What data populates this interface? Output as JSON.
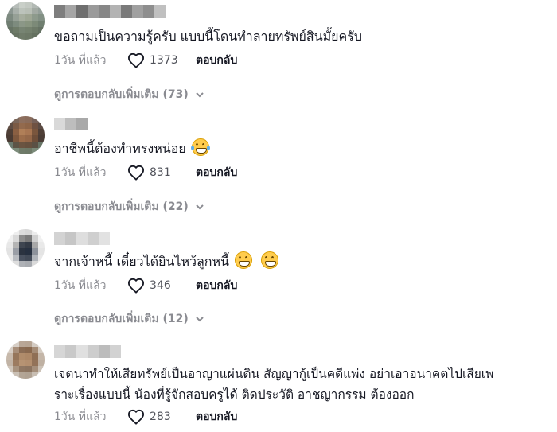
{
  "comments": [
    {
      "text": "ขอถามเป็นความรู้ครับ แบบนี้โดนทำลายทรัพย์สินมั้ยครับ",
      "time": "1วัน ที่แล้ว",
      "likes": "1373",
      "reply_label": "ตอบกลับ",
      "more_replies": "ดูการตอบกลับเพิ่มเติม (73)"
    },
    {
      "text": "อาชีพนี้ต้องทำทรงหน่อย",
      "time": "1วัน ที่แล้ว",
      "likes": "831",
      "reply_label": "ตอบกลับ",
      "more_replies": "ดูการตอบกลับเพิ่มเติม (22)"
    },
    {
      "text": "จากเจ้าหนี้ เดี๋ยวได้ยินไหว้ลูกหนี้",
      "time": "1วัน ที่แล้ว",
      "likes": "346",
      "reply_label": "ตอบกลับ",
      "more_replies": "ดูการตอบกลับเพิ่มเติม (12)"
    },
    {
      "text_line1": "เจตนาทำให้เสียทรัพย์เป็นอาญาแผ่นดิน สัญญากู้เป็นคดีแพ่ง อย่าเอาอนาคตไปเสียเพ",
      "text_line2": "ราะเรื่องแบบนี้ น้องที่รู้จักสอบครูได้ ติดประวัติ อาชญากรรม ต้องออก",
      "time": "1วัน ที่แล้ว",
      "likes": "283",
      "reply_label": "ตอบกลับ"
    }
  ],
  "icons": {
    "like": "heart-outline-icon",
    "chevron": "chevron-down-icon",
    "emoji_joy": "face-with-tears-of-joy-icon",
    "emoji_grin": "grinning-face-icon"
  },
  "colors": {
    "text_primary": "#161823",
    "text_secondary": "#8a8b91"
  }
}
